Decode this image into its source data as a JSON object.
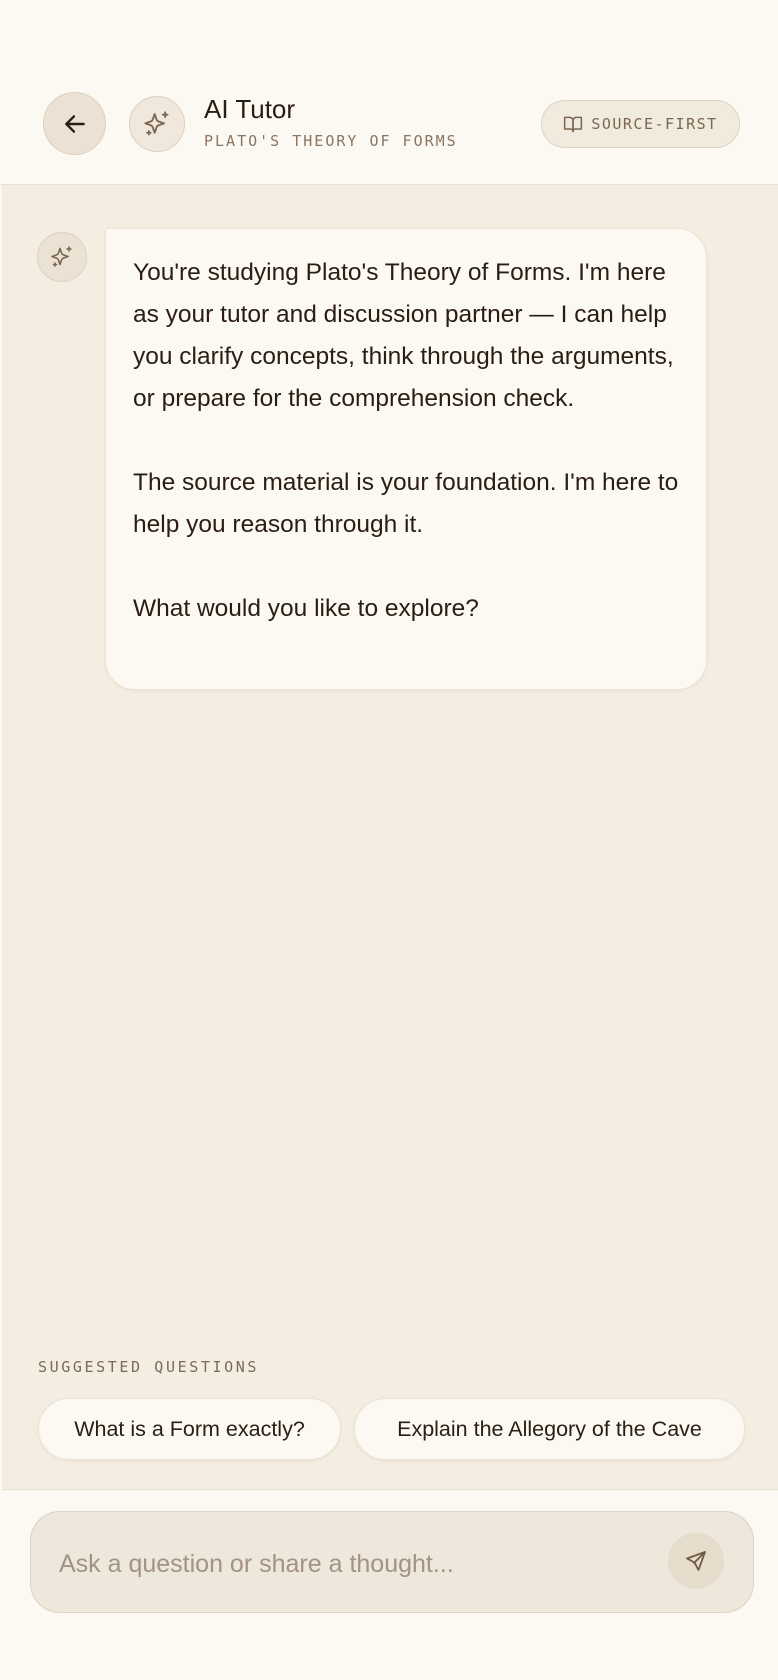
{
  "header": {
    "back_icon": "arrow-left-icon",
    "avatar_icon": "sparkles-icon",
    "title": "AI Tutor",
    "subtitle": "PLATO'S THEORY OF FORMS",
    "badge": {
      "icon": "book-open-icon",
      "label": "SOURCE-FIRST"
    }
  },
  "chat": {
    "messages": [
      {
        "role": "tutor",
        "avatar_icon": "sparkles-icon",
        "paragraphs": [
          "You're studying Plato's Theory of Forms. I'm here as your tutor and discussion partner — I can help you clarify concepts, think through the arguments, or prepare for the comprehension check.",
          "The source material is your foundation. I'm here to help you reason through it.",
          "What would you like to explore?"
        ]
      }
    ]
  },
  "suggestions": {
    "label": "SUGGESTED QUESTIONS",
    "items": [
      "What is a Form exactly?",
      "Explain the Allegory of the Cave"
    ]
  },
  "composer": {
    "placeholder": "Ask a question or share a thought...",
    "value": "",
    "send_icon": "send-icon"
  },
  "colors": {
    "background": "#fcf8f2",
    "chat_background": "#f4ede1",
    "text": "#2a1d12",
    "muted_text": "#8a7561"
  }
}
